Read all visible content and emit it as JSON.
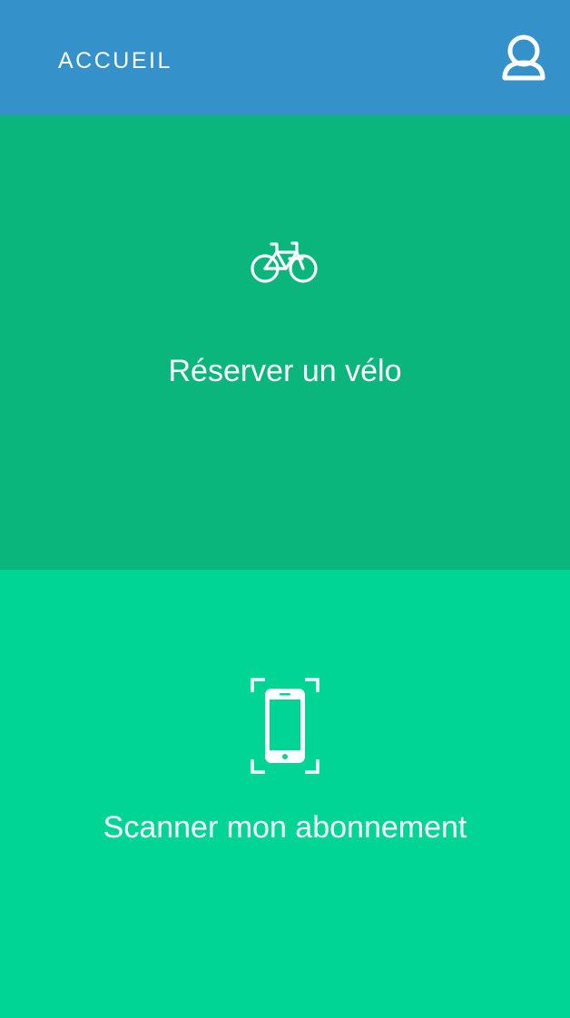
{
  "header": {
    "title": "ACCUEIL",
    "profile_icon": "user-icon",
    "background": "#3591c9"
  },
  "actions": [
    {
      "label": "Réserver un vélo",
      "icon": "bicycle-icon",
      "background": "#0bb67c"
    },
    {
      "label": "Scanner mon abonnement",
      "icon": "phone-scan-icon",
      "background": "#00d596"
    }
  ]
}
